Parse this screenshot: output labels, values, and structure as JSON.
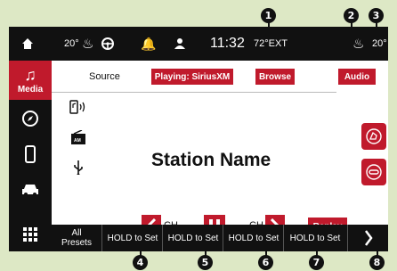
{
  "topbar": {
    "left_temp": "20°",
    "time": "11:32",
    "outside_temp": "72°EXT",
    "right_temp": "20°"
  },
  "sidebar": {
    "items": [
      {
        "label": "Media",
        "icon": "music-note-icon"
      },
      {
        "label": "",
        "icon": "compass-icon"
      },
      {
        "label": "",
        "icon": "phone-icon"
      },
      {
        "label": "",
        "icon": "car-icon"
      },
      {
        "label": "",
        "icon": "apps-grid-icon"
      }
    ]
  },
  "main": {
    "source_label": "Source",
    "playing_label": "Playing: SiriusXM",
    "browse_label": "Browse",
    "audio_label": "Audio",
    "station_name": "Station Name",
    "radio_am_label": "AM",
    "ch_prev_label": "CH",
    "ch_next_label": "CH",
    "replay_label": "Replay"
  },
  "presets": {
    "all_line1": "All",
    "all_line2": "Presets",
    "slots": [
      "HOLD to Set",
      "HOLD to Set",
      "HOLD to Set",
      "HOLD to Set"
    ]
  },
  "callouts": [
    "1",
    "2",
    "3",
    "4",
    "5",
    "6",
    "7",
    "8"
  ],
  "colors": {
    "accent": "#c01a2c",
    "background": "#dde8c5",
    "bar": "#111111"
  }
}
